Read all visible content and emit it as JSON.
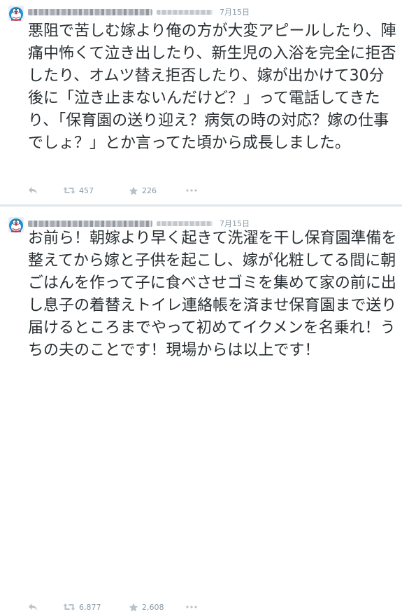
{
  "tweets": [
    {
      "time": "7月15日",
      "text": "悪阻で苦しむ嫁より俺の方が大変アピールしたり、陣痛中怖くて泣き出したり、新生児の入浴を完全に拒否したり、オムツ替え拒否したり、嫁が出かけて30分後に「泣き止まないんだけど？」って電話してきたり、「保育園の送り迎え？病気の時の対応？嫁の仕事でしょ？」とか言ってた頃から成長しました。",
      "retweets": "457",
      "favorites": "226"
    },
    {
      "time": "7月15日",
      "text": "お前ら！朝嫁より早く起きて洗濯を干し保育園準備を整えてから嫁と子供を起こし、嫁が化粧してる間に朝ごはんを作って子に食べさせゴミを集めて家の前に出し息子の着替えトイレ連絡帳を済ませ保育園まで送り届けるところまでやって初めてイクメンを名乗れ！うちの夫のことです！現場からは以上です！",
      "retweets": "6,877",
      "favorites": "2,608"
    }
  ],
  "icons": {
    "reply": "reply-icon",
    "retweet": "retweet-icon",
    "favorite": "star-icon",
    "more": "more-icon",
    "avatar": "doraemon-avatar-icon"
  },
  "colors": {
    "text": "#292f33",
    "muted": "#8899a6",
    "separator": "#e1e8ed"
  }
}
